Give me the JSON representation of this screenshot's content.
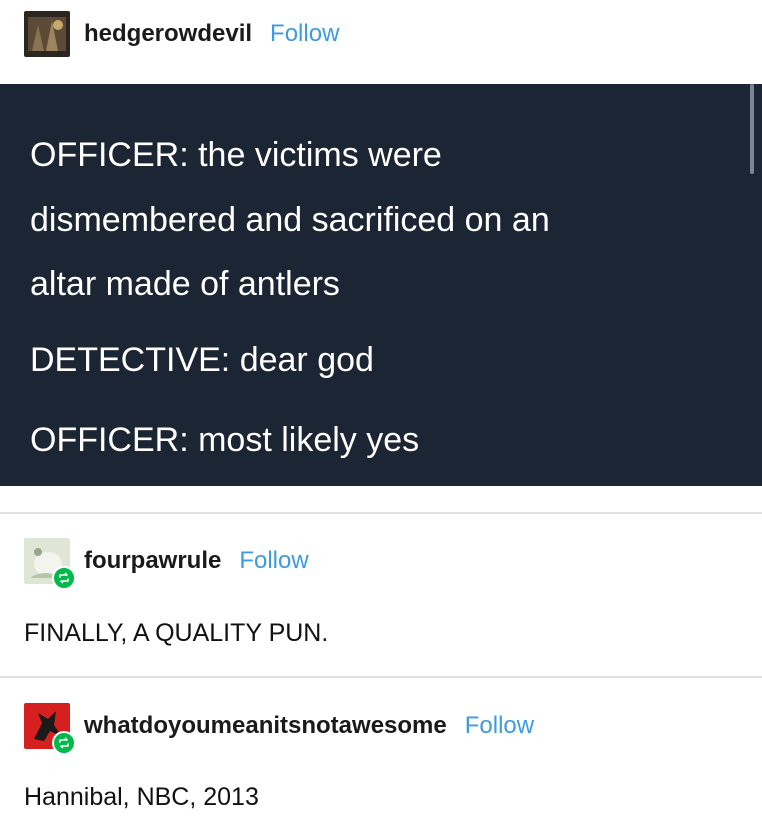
{
  "posts": [
    {
      "username": "hedgerowdevil",
      "follow_label": "Follow",
      "lines": [
        "OFFICER: the victims were",
        "dismembered and sacrificed on an",
        "altar made of antlers",
        "DETECTIVE: dear god",
        "OFFICER: most likely yes"
      ]
    },
    {
      "username": "fourpawrule",
      "follow_label": "Follow",
      "reblog_icon": "reblog-icon",
      "text": "FINALLY, A QUALITY PUN."
    },
    {
      "username": "whatdoyoumeanitsnotawesome",
      "follow_label": "Follow",
      "reblog_icon": "reblog-icon",
      "text": "Hannibal, NBC, 2013"
    }
  ],
  "colors": {
    "panel_bg": "#1c2533",
    "follow": "#3d9be0",
    "reblog_badge": "#00b94a"
  }
}
